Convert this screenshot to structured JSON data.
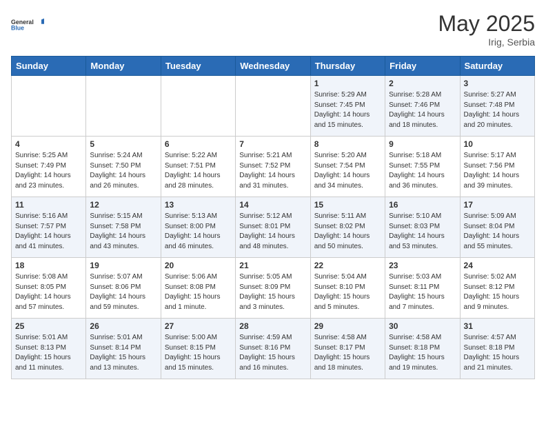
{
  "header": {
    "logo_general": "General",
    "logo_blue": "Blue",
    "month_year": "May 2025",
    "location": "Irig, Serbia"
  },
  "weekdays": [
    "Sunday",
    "Monday",
    "Tuesday",
    "Wednesday",
    "Thursday",
    "Friday",
    "Saturday"
  ],
  "weeks": [
    [
      {
        "day": "",
        "content": ""
      },
      {
        "day": "",
        "content": ""
      },
      {
        "day": "",
        "content": ""
      },
      {
        "day": "",
        "content": ""
      },
      {
        "day": "1",
        "content": "Sunrise: 5:29 AM\nSunset: 7:45 PM\nDaylight: 14 hours\nand 15 minutes."
      },
      {
        "day": "2",
        "content": "Sunrise: 5:28 AM\nSunset: 7:46 PM\nDaylight: 14 hours\nand 18 minutes."
      },
      {
        "day": "3",
        "content": "Sunrise: 5:27 AM\nSunset: 7:48 PM\nDaylight: 14 hours\nand 20 minutes."
      }
    ],
    [
      {
        "day": "4",
        "content": "Sunrise: 5:25 AM\nSunset: 7:49 PM\nDaylight: 14 hours\nand 23 minutes."
      },
      {
        "day": "5",
        "content": "Sunrise: 5:24 AM\nSunset: 7:50 PM\nDaylight: 14 hours\nand 26 minutes."
      },
      {
        "day": "6",
        "content": "Sunrise: 5:22 AM\nSunset: 7:51 PM\nDaylight: 14 hours\nand 28 minutes."
      },
      {
        "day": "7",
        "content": "Sunrise: 5:21 AM\nSunset: 7:52 PM\nDaylight: 14 hours\nand 31 minutes."
      },
      {
        "day": "8",
        "content": "Sunrise: 5:20 AM\nSunset: 7:54 PM\nDaylight: 14 hours\nand 34 minutes."
      },
      {
        "day": "9",
        "content": "Sunrise: 5:18 AM\nSunset: 7:55 PM\nDaylight: 14 hours\nand 36 minutes."
      },
      {
        "day": "10",
        "content": "Sunrise: 5:17 AM\nSunset: 7:56 PM\nDaylight: 14 hours\nand 39 minutes."
      }
    ],
    [
      {
        "day": "11",
        "content": "Sunrise: 5:16 AM\nSunset: 7:57 PM\nDaylight: 14 hours\nand 41 minutes."
      },
      {
        "day": "12",
        "content": "Sunrise: 5:15 AM\nSunset: 7:58 PM\nDaylight: 14 hours\nand 43 minutes."
      },
      {
        "day": "13",
        "content": "Sunrise: 5:13 AM\nSunset: 8:00 PM\nDaylight: 14 hours\nand 46 minutes."
      },
      {
        "day": "14",
        "content": "Sunrise: 5:12 AM\nSunset: 8:01 PM\nDaylight: 14 hours\nand 48 minutes."
      },
      {
        "day": "15",
        "content": "Sunrise: 5:11 AM\nSunset: 8:02 PM\nDaylight: 14 hours\nand 50 minutes."
      },
      {
        "day": "16",
        "content": "Sunrise: 5:10 AM\nSunset: 8:03 PM\nDaylight: 14 hours\nand 53 minutes."
      },
      {
        "day": "17",
        "content": "Sunrise: 5:09 AM\nSunset: 8:04 PM\nDaylight: 14 hours\nand 55 minutes."
      }
    ],
    [
      {
        "day": "18",
        "content": "Sunrise: 5:08 AM\nSunset: 8:05 PM\nDaylight: 14 hours\nand 57 minutes."
      },
      {
        "day": "19",
        "content": "Sunrise: 5:07 AM\nSunset: 8:06 PM\nDaylight: 14 hours\nand 59 minutes."
      },
      {
        "day": "20",
        "content": "Sunrise: 5:06 AM\nSunset: 8:08 PM\nDaylight: 15 hours\nand 1 minute."
      },
      {
        "day": "21",
        "content": "Sunrise: 5:05 AM\nSunset: 8:09 PM\nDaylight: 15 hours\nand 3 minutes."
      },
      {
        "day": "22",
        "content": "Sunrise: 5:04 AM\nSunset: 8:10 PM\nDaylight: 15 hours\nand 5 minutes."
      },
      {
        "day": "23",
        "content": "Sunrise: 5:03 AM\nSunset: 8:11 PM\nDaylight: 15 hours\nand 7 minutes."
      },
      {
        "day": "24",
        "content": "Sunrise: 5:02 AM\nSunset: 8:12 PM\nDaylight: 15 hours\nand 9 minutes."
      }
    ],
    [
      {
        "day": "25",
        "content": "Sunrise: 5:01 AM\nSunset: 8:13 PM\nDaylight: 15 hours\nand 11 minutes."
      },
      {
        "day": "26",
        "content": "Sunrise: 5:01 AM\nSunset: 8:14 PM\nDaylight: 15 hours\nand 13 minutes."
      },
      {
        "day": "27",
        "content": "Sunrise: 5:00 AM\nSunset: 8:15 PM\nDaylight: 15 hours\nand 15 minutes."
      },
      {
        "day": "28",
        "content": "Sunrise: 4:59 AM\nSunset: 8:16 PM\nDaylight: 15 hours\nand 16 minutes."
      },
      {
        "day": "29",
        "content": "Sunrise: 4:58 AM\nSunset: 8:17 PM\nDaylight: 15 hours\nand 18 minutes."
      },
      {
        "day": "30",
        "content": "Sunrise: 4:58 AM\nSunset: 8:18 PM\nDaylight: 15 hours\nand 19 minutes."
      },
      {
        "day": "31",
        "content": "Sunrise: 4:57 AM\nSunset: 8:18 PM\nDaylight: 15 hours\nand 21 minutes."
      }
    ]
  ]
}
